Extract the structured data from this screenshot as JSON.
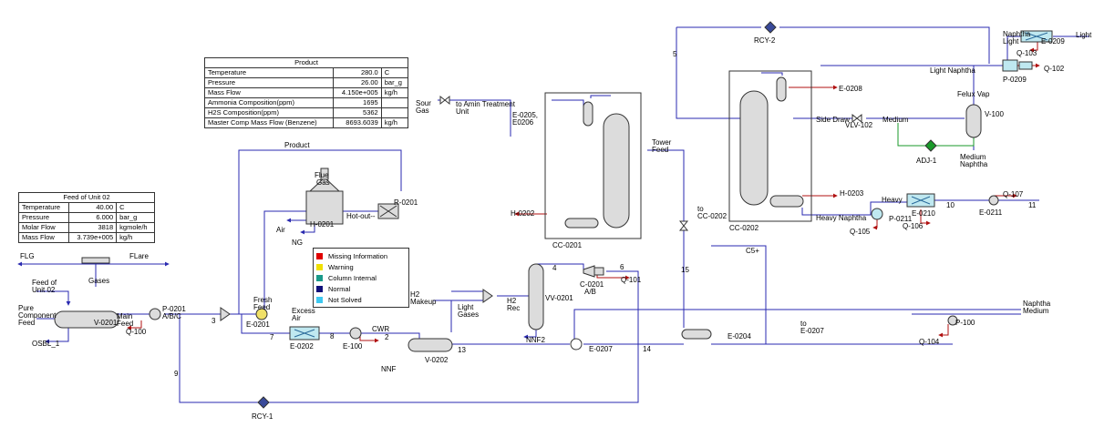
{
  "product_table": {
    "title": "Product",
    "rows": [
      {
        "label": "Temperature",
        "value": "280.0",
        "unit": "C"
      },
      {
        "label": "Pressure",
        "value": "26.00",
        "unit": "bar_g"
      },
      {
        "label": "Mass Flow",
        "value": "4.150e+005",
        "unit": "kg/h"
      },
      {
        "label": "Ammonia Composition(ppm)",
        "value": "1695",
        "unit": ""
      },
      {
        "label": "H2S Composition(ppm)",
        "value": "5362",
        "unit": ""
      },
      {
        "label": "Master Comp Mass Flow (Benzene)",
        "value": "8693.6039",
        "unit": "kg/h"
      }
    ]
  },
  "feed_table": {
    "title": "Feed of Unit 02",
    "rows": [
      {
        "label": "Temperature",
        "value": "40.00",
        "unit": "C"
      },
      {
        "label": "Pressure",
        "value": "6.000",
        "unit": "bar_g"
      },
      {
        "label": "Molar Flow",
        "value": "3818",
        "unit": "kgmole/h"
      },
      {
        "label": "Mass Flow",
        "value": "3.739e+005",
        "unit": "kg/h"
      }
    ]
  },
  "legend": [
    {
      "label": "Missing Information",
      "color": "#e00000"
    },
    {
      "label": "Warning",
      "color": "#f0e000"
    },
    {
      "label": "Column Internal",
      "color": "#1a9a8a"
    },
    {
      "label": "Normal",
      "color": "#10107a"
    },
    {
      "label": "Not Solved",
      "color": "#3ec8f0"
    }
  ],
  "colors": {
    "stream": "#2a2ab0",
    "energy": "#b01010",
    "logic": "#1a9a2a"
  },
  "labels": {
    "flg": "FLG",
    "flare": "FLare",
    "gases": "Gases",
    "feed_unit02_1": "Feed of",
    "feed_unit02_2": "Unit 02",
    "pure_1": "Pure",
    "pure_2": "Component",
    "pure_3": "Feed",
    "osbl": "OSBL_1",
    "v0201": "V-0201",
    "main_feed_1": "Main",
    "main_feed_2": "Feed",
    "q100": "Q-100",
    "p0201_1": "P-0201",
    "p0201_2": "A/B/C",
    "s3": "3",
    "s9": "9",
    "s7": "7",
    "s8": "8",
    "s2": "2",
    "s13": "13",
    "s14": "14",
    "s4": "4",
    "s6": "6",
    "s15": "15",
    "s5": "5",
    "s10": "10",
    "s11": "11",
    "fresh_1": "Fresh",
    "fresh_2": "Feed",
    "e0201": "E-0201",
    "excess_1": "Excess",
    "excess_2": "Air",
    "e0202": "E-0202",
    "e100": "E-100",
    "cwr": "CWR",
    "v0202": "V-0202",
    "nnf": "NNF",
    "product": "Product",
    "flue_1": "Flue",
    "flue_2": "Gas",
    "h0201": "H-0201",
    "hot_out": "Hot-out--",
    "r0201": "R-0201",
    "air": "Air",
    "ng": "NG",
    "h2_makeup_1": "H2",
    "h2_makeup_2": "Makeup",
    "light_gases_1": "Light",
    "light_gases_2": "Gases",
    "h2rec_1": "H2",
    "h2rec_2": "Rec",
    "vv0201": "VV-0201",
    "nnf2": "NNF2",
    "c0201_1": "C-0201",
    "c0201_2": "A/B",
    "q101": "Q-101",
    "sour_1": "Sour",
    "sour_2": "Gas",
    "amin_1": "to Amin Treatment",
    "amin_2": "Unit",
    "e0205_1": "E-0205,",
    "e0205_2": "E0206",
    "tower_1": "Tower",
    "tower_2": "Feed",
    "h0202": "H-0202",
    "cc0201": "CC-0201",
    "e0207": "E-0207",
    "e0204": "E-0204",
    "to_e0207_1": "to",
    "to_e0207_2": "E-0207",
    "c5": "C5+",
    "to_cc_1": "to",
    "to_cc_2": "CC-0202",
    "cc0202": "CC-0202",
    "rcy2": "RCY-2",
    "rcy1": "RCY-1",
    "e0208": "E-0208",
    "side_draw": "Side Draw",
    "vlv102": "VLV-102",
    "medium": "Medium",
    "v100": "V-100",
    "felux": "Felux Vap",
    "adj1": "ADJ-1",
    "med_naph_1": "Medium",
    "med_naph_2": "Naphtha",
    "h0203": "H-0203",
    "heavy": "Heavy",
    "heavy_naphtha": "Heavy Naphtha",
    "p0211": "P-0211",
    "q105": "Q-105",
    "e0210": "E-0210",
    "q106": "Q-106",
    "e0211": "E-0211",
    "q107": "Q-107",
    "naph_out_1": "Naphtha",
    "naph_out_2": "Medium",
    "p100": "P-100",
    "q104": "Q-104",
    "light_naphtha": "Light Naphtha",
    "p0209": "P-0209",
    "q102": "Q-102",
    "naph_light_1": "Naphtha",
    "naph_light_2": "Light",
    "q103": "Q-103",
    "e0209": "E-0209",
    "light": "Light"
  }
}
